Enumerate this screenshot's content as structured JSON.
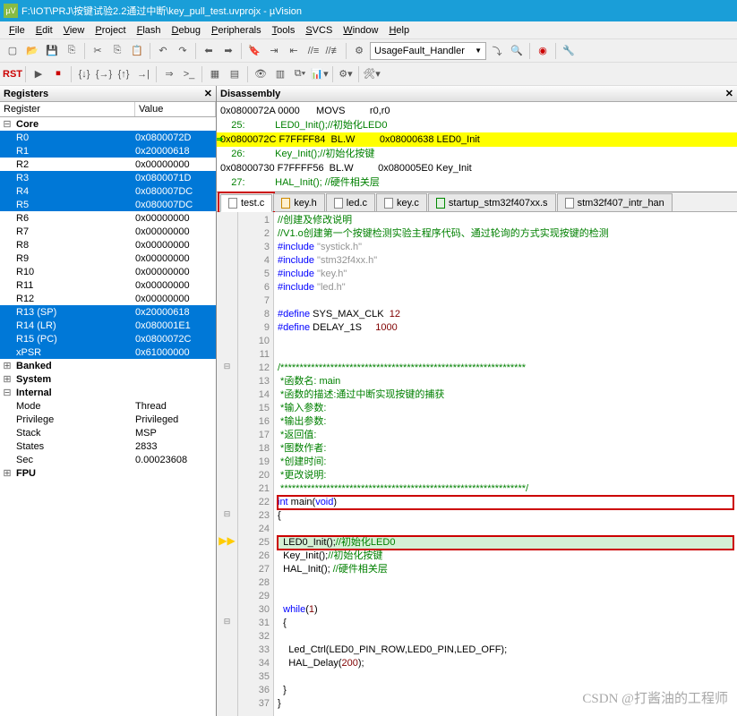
{
  "title": "F:\\IOT\\PRJ\\按键试验2.2通过中断\\key_pull_test.uvprojx - µVision",
  "menus": [
    "File",
    "Edit",
    "View",
    "Project",
    "Flash",
    "Debug",
    "Peripherals",
    "Tools",
    "SVCS",
    "Window",
    "Help"
  ],
  "menu_accel": [
    "F",
    "E",
    "V",
    "P",
    "F",
    "D",
    "P",
    "T",
    "S",
    "W",
    "H"
  ],
  "combo_handler": "UsageFault_Handler",
  "panels": {
    "registers": "Registers",
    "disasm": "Disassembly"
  },
  "reg_cols": {
    "c1": "Register",
    "c2": "Value"
  },
  "registers": {
    "core_label": "Core",
    "core": [
      {
        "n": "R0",
        "v": "0x0800072D",
        "sel": true
      },
      {
        "n": "R1",
        "v": "0x20000618",
        "sel": true
      },
      {
        "n": "R2",
        "v": "0x00000000"
      },
      {
        "n": "R3",
        "v": "0x0800071D",
        "sel": true
      },
      {
        "n": "R4",
        "v": "0x080007DC",
        "sel": true
      },
      {
        "n": "R5",
        "v": "0x080007DC",
        "sel": true
      },
      {
        "n": "R6",
        "v": "0x00000000"
      },
      {
        "n": "R7",
        "v": "0x00000000"
      },
      {
        "n": "R8",
        "v": "0x00000000"
      },
      {
        "n": "R9",
        "v": "0x00000000"
      },
      {
        "n": "R10",
        "v": "0x00000000"
      },
      {
        "n": "R11",
        "v": "0x00000000"
      },
      {
        "n": "R12",
        "v": "0x00000000"
      },
      {
        "n": "R13 (SP)",
        "v": "0x20000618",
        "sel": true
      },
      {
        "n": "R14 (LR)",
        "v": "0x080001E1",
        "sel": true
      },
      {
        "n": "R15 (PC)",
        "v": "0x0800072C",
        "sel": true
      },
      {
        "n": "xPSR",
        "v": "0x61000000",
        "sel": true
      }
    ],
    "groups": [
      {
        "n": "Banked"
      },
      {
        "n": "System"
      },
      {
        "n": "Internal",
        "open": true,
        "children": [
          {
            "n": "Mode",
            "v": "Thread"
          },
          {
            "n": "Privilege",
            "v": "Privileged"
          },
          {
            "n": "Stack",
            "v": "MSP"
          },
          {
            "n": "States",
            "v": "2833"
          },
          {
            "n": "Sec",
            "v": "0.00023608"
          }
        ]
      },
      {
        "n": "FPU"
      }
    ]
  },
  "disasm": [
    {
      "t": "0x0800072A 0000      MOVS         r0,r0"
    },
    {
      "t": "    25:           LED0_Init();//初始化LED0",
      "g": true
    },
    {
      "t": "0x0800072C F7FFFF84  BL.W         0x08000638 LED0_Init",
      "hl": true,
      "cur": true
    },
    {
      "t": "    26:           Key_Init();//初始化按键",
      "g": true
    },
    {
      "t": "0x08000730 F7FFFF56  BL.W         0x080005E0 Key_Init"
    },
    {
      "t": "    27:           HAL_Init(); //硬件相关层",
      "g": true
    }
  ],
  "tabs": [
    {
      "l": "test.c",
      "t": "c",
      "active": true,
      "box": true
    },
    {
      "l": "key.h",
      "t": "h"
    },
    {
      "l": "led.c",
      "t": "c"
    },
    {
      "l": "key.c",
      "t": "c"
    },
    {
      "l": "startup_stm32f407xx.s",
      "t": "s"
    },
    {
      "l": "stm32f407_intr_han",
      "t": "c"
    }
  ],
  "code": [
    {
      "n": 1,
      "seg": [
        {
          "c": "c-green",
          "t": "//创建及修改说明"
        }
      ]
    },
    {
      "n": 2,
      "seg": [
        {
          "c": "c-green",
          "t": "//V1.o创建第一个按键检测实验主程序代码、通过轮询的方式实现按键的检测"
        }
      ]
    },
    {
      "n": 3,
      "seg": [
        {
          "c": "c-blue",
          "t": "#include "
        },
        {
          "c": "c-str",
          "t": "\"systick.h\""
        }
      ]
    },
    {
      "n": 4,
      "seg": [
        {
          "c": "c-blue",
          "t": "#include "
        },
        {
          "c": "c-str",
          "t": "\"stm32f4xx.h\""
        }
      ]
    },
    {
      "n": 5,
      "seg": [
        {
          "c": "c-blue",
          "t": "#include "
        },
        {
          "c": "c-str",
          "t": "\"key.h\""
        }
      ]
    },
    {
      "n": 6,
      "seg": [
        {
          "c": "c-blue",
          "t": "#include "
        },
        {
          "c": "c-str",
          "t": "\"led.h\""
        }
      ]
    },
    {
      "n": 7,
      "seg": [
        {
          "t": ""
        }
      ]
    },
    {
      "n": 8,
      "seg": [
        {
          "c": "c-blue",
          "t": "#define "
        },
        {
          "t": "SYS_MAX_CLK  "
        },
        {
          "c": "c-num",
          "t": "12"
        }
      ]
    },
    {
      "n": 9,
      "seg": [
        {
          "c": "c-blue",
          "t": "#define "
        },
        {
          "t": "DELAY_1S     "
        },
        {
          "c": "c-num",
          "t": "1000"
        }
      ]
    },
    {
      "n": 10,
      "seg": [
        {
          "t": ""
        }
      ]
    },
    {
      "n": 11,
      "seg": [
        {
          "t": ""
        }
      ]
    },
    {
      "n": 12,
      "m": "⊟",
      "seg": [
        {
          "c": "c-green",
          "t": "/****************************************************************"
        }
      ]
    },
    {
      "n": 13,
      "seg": [
        {
          "c": "c-green",
          "t": " *函数名: main"
        }
      ]
    },
    {
      "n": 14,
      "seg": [
        {
          "c": "c-green",
          "t": " *函数的描述:通过中断实现按键的捕获"
        }
      ]
    },
    {
      "n": 15,
      "seg": [
        {
          "c": "c-green",
          "t": " *输入参数:"
        }
      ]
    },
    {
      "n": 16,
      "seg": [
        {
          "c": "c-green",
          "t": " *输出参数:"
        }
      ]
    },
    {
      "n": 17,
      "seg": [
        {
          "c": "c-green",
          "t": " *返回值:"
        }
      ]
    },
    {
      "n": 18,
      "seg": [
        {
          "c": "c-green",
          "t": " *图数作者:"
        }
      ]
    },
    {
      "n": 19,
      "seg": [
        {
          "c": "c-green",
          "t": " *创建时间:"
        }
      ]
    },
    {
      "n": 20,
      "seg": [
        {
          "c": "c-green",
          "t": " *更改说明:"
        }
      ]
    },
    {
      "n": 21,
      "seg": [
        {
          "c": "c-green",
          "t": " ****************************************************************/"
        }
      ]
    },
    {
      "n": 22,
      "box": true,
      "seg": [
        {
          "c": "c-kw",
          "t": "int"
        },
        {
          "t": " main("
        },
        {
          "c": "c-kw",
          "t": "void"
        },
        {
          "t": ")"
        }
      ]
    },
    {
      "n": 23,
      "m": "⊟",
      "seg": [
        {
          "t": "{"
        }
      ]
    },
    {
      "n": 24,
      "seg": [
        {
          "t": ""
        }
      ]
    },
    {
      "n": 25,
      "cur": true,
      "box": true,
      "bp": true,
      "seg": [
        {
          "t": "  LED0_Init();"
        },
        {
          "c": "c-green",
          "t": "//初始化LED0"
        }
      ]
    },
    {
      "n": 26,
      "seg": [
        {
          "t": "  Key_Init();"
        },
        {
          "c": "c-green",
          "t": "//初始化按键"
        }
      ]
    },
    {
      "n": 27,
      "seg": [
        {
          "t": "  HAL_Init(); "
        },
        {
          "c": "c-green",
          "t": "//硬件相关层"
        }
      ]
    },
    {
      "n": 28,
      "seg": [
        {
          "t": ""
        }
      ]
    },
    {
      "n": 29,
      "seg": [
        {
          "t": ""
        }
      ]
    },
    {
      "n": 30,
      "seg": [
        {
          "t": "  "
        },
        {
          "c": "c-kw",
          "t": "while"
        },
        {
          "t": "("
        },
        {
          "c": "c-num",
          "t": "1"
        },
        {
          "t": ")"
        }
      ]
    },
    {
      "n": 31,
      "m": "⊟",
      "seg": [
        {
          "t": "  {"
        }
      ]
    },
    {
      "n": 32,
      "seg": [
        {
          "t": ""
        }
      ]
    },
    {
      "n": 33,
      "seg": [
        {
          "t": "    Led_Ctrl(LED0_PIN_ROW,LED0_PIN,LED_OFF);"
        }
      ]
    },
    {
      "n": 34,
      "seg": [
        {
          "t": "    HAL_Delay("
        },
        {
          "c": "c-num",
          "t": "200"
        },
        {
          "t": ");"
        }
      ]
    },
    {
      "n": 35,
      "seg": [
        {
          "t": ""
        }
      ]
    },
    {
      "n": 36,
      "seg": [
        {
          "t": "  }"
        }
      ]
    },
    {
      "n": 37,
      "seg": [
        {
          "t": "}"
        }
      ]
    }
  ],
  "watermark": "CSDN @打酱油的工程师"
}
